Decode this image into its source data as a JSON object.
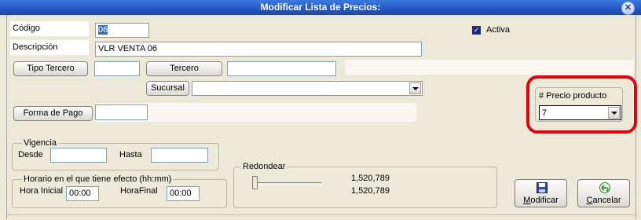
{
  "window": {
    "title": "Modificar Lista de Precios:"
  },
  "form": {
    "codigo_label": "Código",
    "codigo_value": "06",
    "descripcion_label": "Descripción",
    "descripcion_value": "VLR VENTA 06",
    "activa_label": "Activa",
    "activa_checked": true,
    "tipo_tercero_button": "Tipo Tercero",
    "tercero_button": "Tercero",
    "sucursal_button": "Sucursal",
    "forma_pago_button": "Forma de Pago"
  },
  "precio_producto": {
    "label": "# Precio producto",
    "value": "7"
  },
  "vigencia": {
    "legend": "Vigencia",
    "desde_label": "Desde",
    "hasta_label": "Hasta"
  },
  "horario": {
    "legend": "Horario en el que tiene efecto  (hh:mm)",
    "hora_inicial_label": "Hora Inicial",
    "hora_inicial_value": "00:00",
    "hora_final_label": "HoraFinal",
    "hora_final_value": "00:00"
  },
  "redondear": {
    "legend": "Redondear",
    "value1": "1,520,789",
    "value2": "1,520,789"
  },
  "actions": {
    "modificar_prefix": "M",
    "modificar_rest": "odificar",
    "cancelar_prefix": "C",
    "cancelar_rest": "ancelar"
  },
  "icons": {
    "close": "close-icon",
    "save": "floppy-disk-icon",
    "cancel": "undo-arrow-icon",
    "check": "checkmark-icon"
  },
  "colors": {
    "titlebar": "#2456c4",
    "highlight_box": "#e3000f",
    "selection": "#316ac5"
  }
}
